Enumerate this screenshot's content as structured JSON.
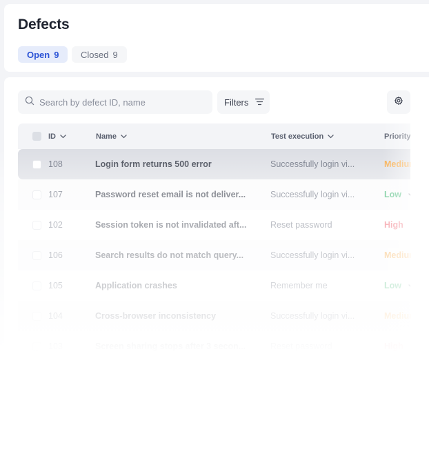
{
  "page": {
    "title": "Defects"
  },
  "tabs": [
    {
      "label": "Open",
      "count": "9"
    },
    {
      "label": "Closed",
      "count": "9"
    }
  ],
  "toolbar": {
    "search_placeholder": "Search by defect ID, name",
    "filters_label": "Filters"
  },
  "table": {
    "columns": [
      "ID",
      "Name",
      "Test execution",
      "Priority"
    ],
    "rows": [
      {
        "id": "108",
        "name": "Login form returns 500 error",
        "execution": "Successfully login vi...",
        "priority": "Medium",
        "selected": true
      },
      {
        "id": "107",
        "name": "Password reset email is not deliver...",
        "execution": "Successfully login vi...",
        "priority": "Low"
      },
      {
        "id": "102",
        "name": "Session token is not invalidated aft...",
        "execution": "Reset password",
        "priority": "High"
      },
      {
        "id": "106",
        "name": "Search results do not match query...",
        "execution": "Successfully login vi...",
        "priority": "Medium"
      },
      {
        "id": "105",
        "name": "Application crashes",
        "execution": "Remember me",
        "priority": "Low"
      },
      {
        "id": "104",
        "name": "Cross-browser inconsistency",
        "execution": "Successfully login vi...",
        "priority": "Medium"
      },
      {
        "id": "103",
        "name": "Screen sharing stops after 3 secon...",
        "execution": "Reset password",
        "priority": "High"
      }
    ]
  },
  "colors": {
    "accent": "#2c54d6",
    "priority_medium": "#f6a43a",
    "priority_low": "#34b26a",
    "priority_high": "#ec4e5c"
  }
}
